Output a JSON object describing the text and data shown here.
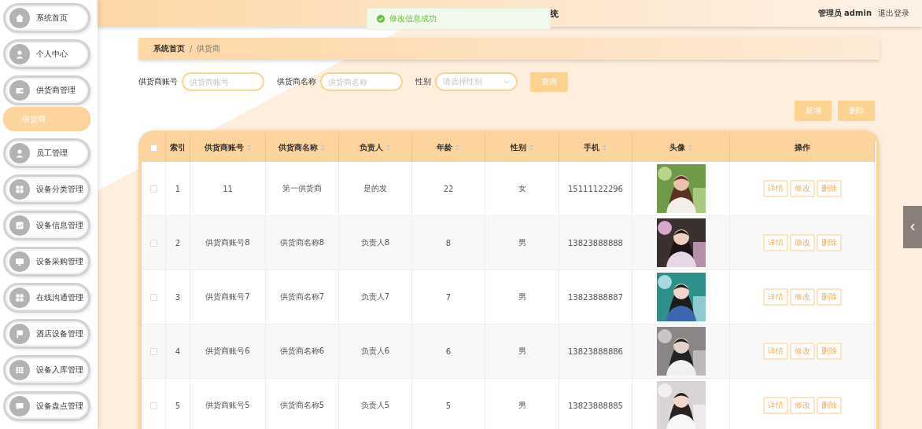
{
  "header": {
    "title": "统",
    "user": "管理员 admin",
    "logout": "退出登录"
  },
  "toast": {
    "message": "修改信息成功"
  },
  "sidebar": {
    "items": [
      {
        "label": "系统首页",
        "selected": false
      },
      {
        "label": "个人中心",
        "selected": false
      },
      {
        "label": "供货商管理",
        "selected": false,
        "children": [
          {
            "label": "供货商",
            "selected": true
          }
        ]
      },
      {
        "label": "员工管理",
        "selected": false
      },
      {
        "label": "设备分类管理",
        "selected": false
      },
      {
        "label": "设备信息管理",
        "selected": false
      },
      {
        "label": "设备采购管理",
        "selected": false
      },
      {
        "label": "在线沟通管理",
        "selected": false
      },
      {
        "label": "酒店设备管理",
        "selected": false
      },
      {
        "label": "设备入库管理",
        "selected": false
      },
      {
        "label": "设备盘点管理",
        "selected": false
      }
    ]
  },
  "breadcrumb": {
    "separator": "/",
    "items": [
      "系统首页",
      "供货商"
    ]
  },
  "search": {
    "fields": [
      {
        "kind": "input",
        "label": "供货商账号",
        "placeholder": "供货商账号"
      },
      {
        "kind": "input",
        "label": "供货商名称",
        "placeholder": "供货商名称"
      },
      {
        "kind": "select",
        "label": "性别",
        "placeholder": "请选择性别"
      }
    ],
    "button": "查询"
  },
  "actions": [
    "新增",
    "删除"
  ],
  "table": {
    "header_checked": false,
    "columns": [
      {
        "label": "索引",
        "sortable": false
      },
      {
        "label": "供货商账号",
        "sortable": true
      },
      {
        "label": "供货商名称",
        "sortable": true
      },
      {
        "label": "负责人",
        "sortable": true
      },
      {
        "label": "年龄",
        "sortable": true
      },
      {
        "label": "性别",
        "sortable": true
      },
      {
        "label": "手机",
        "sortable": true
      },
      {
        "label": "头像",
        "sortable": true
      },
      {
        "label": "操作",
        "sortable": false
      }
    ],
    "rows": [
      {
        "checked": false,
        "cells": [
          "1",
          "11",
          "第一供货商",
          "是的发",
          "22",
          "女",
          "15111122296"
        ],
        "actions": [
          "详情",
          "修改",
          "删除"
        ]
      },
      {
        "checked": false,
        "cells": [
          "2",
          "供货商账号8",
          "供货商名称8",
          "负责人8",
          "8",
          "男",
          "13823888888"
        ],
        "actions": [
          "详情",
          "修改",
          "删除"
        ]
      },
      {
        "checked": false,
        "cells": [
          "3",
          "供货商账号7",
          "供货商名称7",
          "负责人7",
          "7",
          "男",
          "13823888887"
        ],
        "actions": [
          "详情",
          "修改",
          "删除"
        ]
      },
      {
        "checked": false,
        "cells": [
          "4",
          "供货商账号6",
          "供货商名称6",
          "负责人6",
          "6",
          "男",
          "13823888886"
        ],
        "actions": [
          "详情",
          "修改",
          "删除"
        ]
      },
      {
        "checked": false,
        "cells": [
          "5",
          "供货商账号5",
          "供货商名称5",
          "负责人5",
          "5",
          "男",
          "13823888885"
        ],
        "actions": [
          "详情",
          "修改",
          "删除"
        ]
      }
    ]
  }
}
